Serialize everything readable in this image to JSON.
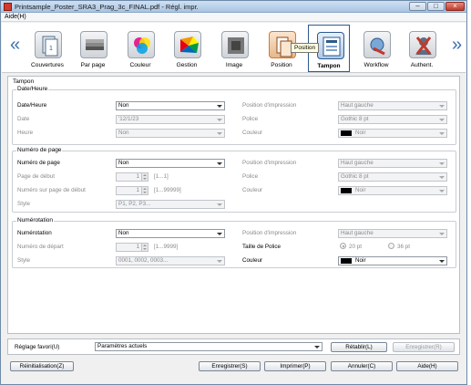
{
  "window": {
    "title": "Printsample_Poster_SRA3_Prag_3c_FINAL.pdf - Régl. impr."
  },
  "menu": {
    "help": "Aide(H)"
  },
  "nav": {
    "prev": "«",
    "next": "»"
  },
  "tabs": [
    {
      "label": "Couvertures",
      "icon": "covers-icon"
    },
    {
      "label": "Par page",
      "icon": "per-page-icon"
    },
    {
      "label": "Couleur",
      "icon": "color-icon"
    },
    {
      "label": "Gestion",
      "icon": "management-icon"
    },
    {
      "label": "Image",
      "icon": "image-icon"
    },
    {
      "label": "Position",
      "icon": "position-icon"
    },
    {
      "label": "Tampon",
      "icon": "stamp-icon"
    },
    {
      "label": "Workflow",
      "icon": "workflow-icon"
    },
    {
      "label": "Authent.",
      "icon": "authentication-icon"
    }
  ],
  "tooltip": "Position",
  "stamp": {
    "section_title": "Tampon",
    "date_group": {
      "title": "Date/Heure",
      "date_time_label": "Date/Heure",
      "date_time_value": "Non",
      "date_label": "Date",
      "date_value": "'12/1/23",
      "time_label": "Heure",
      "time_value": "Non",
      "position_label": "Position d'impression",
      "position_value": "Haut gauche",
      "font_label": "Police",
      "font_value": "Gothic 8 pt",
      "color_label": "Couleur",
      "color_value": "Noir"
    },
    "page_group": {
      "title": "Numéro de page",
      "page_number_label": "Numéro de page",
      "page_number_value": "Non",
      "start_page_label": "Page de début",
      "start_page_value": "1",
      "start_page_range": "[1...1]",
      "start_number_label": "Numéro sur page de début",
      "start_number_value": "1",
      "start_number_range": "[1...99999]",
      "style_label": "Style",
      "style_value": "P1, P2, P3...",
      "position_label": "Position d'impression",
      "position_value": "Haut gauche",
      "font_label": "Police",
      "font_value": "Gothic 8 pt",
      "color_label": "Couleur",
      "color_value": "Noir"
    },
    "numbering_group": {
      "title": "Numérotation",
      "numbering_label": "Numérotation",
      "numbering_value": "Non",
      "start_number_label": "Numéro de départ",
      "start_number_value": "1",
      "start_number_range": "[1...9999]",
      "style_label": "Style",
      "style_value": "0001, 0002, 0003...",
      "position_label": "Position d'impression",
      "position_value": "Haut gauche",
      "font_size_label": "Taille de Police",
      "font_size_opt1": "20 pt",
      "font_size_opt2": "36 pt",
      "color_label": "Couleur",
      "color_value": "Noir"
    }
  },
  "favorites": {
    "label": "Réglage favori(U)",
    "value": "Paramètres actuels",
    "recall": "Rétablir(L)",
    "save": "Enregistrer(R)"
  },
  "footer": {
    "reset": "Réinitialisation(Z)",
    "save": "Enregistrer(S)",
    "print": "Imprimer(P)",
    "cancel": "Annuler(C)",
    "help": "Aide(H)"
  },
  "colors": {
    "accent": "#2b5a8d",
    "swatch": "#000000"
  }
}
